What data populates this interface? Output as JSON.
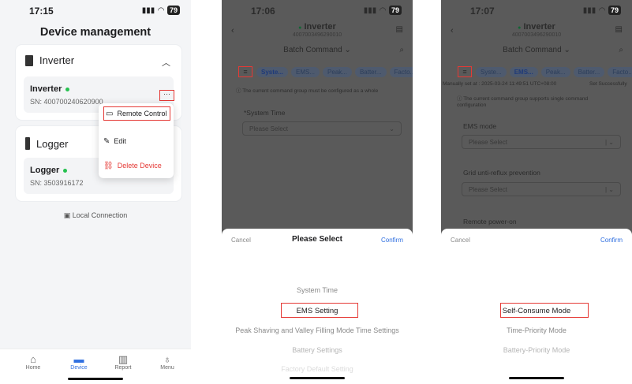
{
  "status_bar": {
    "p1_time": "17:15",
    "p2_time": "17:06",
    "p3_time": "17:07",
    "battery": "79",
    "signal_icon": "signal-icon",
    "wifi_icon": "wifi-icon"
  },
  "screen1": {
    "title": "Device management",
    "inverter_card": {
      "label": "Inverter",
      "device_name": "Inverter",
      "sn": "SN: 400700240620900"
    },
    "logger_card": {
      "label": "Logger",
      "device_name": "Logger",
      "sn": "SN: 3503916172"
    },
    "more_button": "···",
    "context_menu": {
      "remote_control": "Remote Control",
      "edit": "Edit",
      "delete": "Delete Device"
    },
    "local_connection": "Local Connection",
    "tabs": [
      {
        "label": "Home",
        "icon": "home-icon",
        "active": false
      },
      {
        "label": "Device",
        "icon": "device-icon",
        "active": true
      },
      {
        "label": "Report",
        "icon": "report-icon",
        "active": false
      },
      {
        "label": "Menu",
        "icon": "user-icon",
        "active": false
      }
    ],
    "accent_color": "#2f6fe0",
    "highlight_color": "#e53935"
  },
  "screen2": {
    "nav": {
      "title": "Inverter",
      "serial": "4007003496290010",
      "batch": "Batch Command"
    },
    "chips": [
      "Syste...",
      "EMS...",
      "Peak...",
      "Batter...",
      "Facto..."
    ],
    "note": "The current command group must be configured as a whole",
    "field_label": "*System Time",
    "field_placeholder": "Please Select",
    "sheet": {
      "cancel": "Cancel",
      "title": "Please Select",
      "confirm": "Confirm",
      "options": [
        "System Time",
        "EMS Setting",
        "Peak Shaving and Valley Filling Mode Time Settings",
        "Battery Settings",
        "Factory Default Setting"
      ],
      "selected": "EMS Setting"
    }
  },
  "screen3": {
    "nav": {
      "title": "Inverter",
      "serial": "4007003496290010",
      "batch": "Batch Command"
    },
    "chips": [
      "Syste...",
      "EMS...",
      "Peak...",
      "Batter...",
      "Facto..."
    ],
    "set_info": "Manually set at : 2025-03-24 11:49:51 UTC+08:00",
    "set_status": "Set Successfully",
    "note": "The current command group supports single command configuration",
    "fields": [
      {
        "label": "EMS mode",
        "placeholder": "Please Select"
      },
      {
        "label": "Grid unti-reflux prevention",
        "placeholder": "Please Select"
      },
      {
        "label": "Remote power-on",
        "placeholder": ""
      }
    ],
    "sheet": {
      "cancel": "Cancel",
      "confirm": "Confirm",
      "options": [
        "Self-Consume Mode",
        "Time-Priority Mode",
        "Battery-Priority Mode"
      ],
      "selected": "Self-Consume Mode"
    }
  }
}
